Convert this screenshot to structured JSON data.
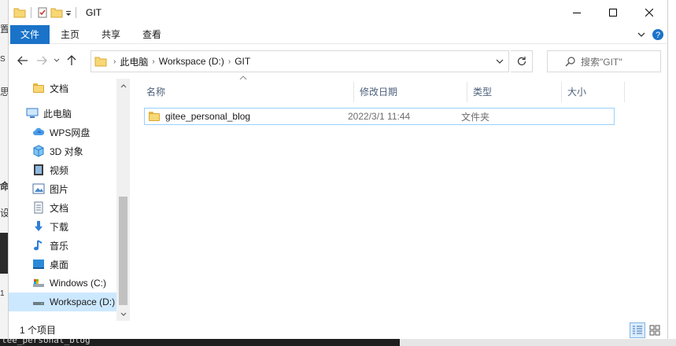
{
  "window": {
    "title": "GIT"
  },
  "ribbon": {
    "tabs": [
      "文件",
      "主页",
      "共享",
      "查看"
    ]
  },
  "address": {
    "crumbs": [
      "此电脑",
      "Workspace (D:)",
      "GIT"
    ]
  },
  "search": {
    "placeholder": "搜索\"GIT\""
  },
  "navpane": {
    "items": [
      {
        "label": "文档",
        "icon": "folder-icon"
      },
      {
        "label": "此电脑",
        "icon": "computer-icon"
      },
      {
        "label": "WPS网盘",
        "icon": "cloud-icon"
      },
      {
        "label": "3D 对象",
        "icon": "cube-icon"
      },
      {
        "label": "视频",
        "icon": "video-icon"
      },
      {
        "label": "图片",
        "icon": "picture-icon"
      },
      {
        "label": "文档",
        "icon": "document-icon"
      },
      {
        "label": "下载",
        "icon": "download-icon"
      },
      {
        "label": "音乐",
        "icon": "music-icon"
      },
      {
        "label": "桌面",
        "icon": "desktop-icon"
      },
      {
        "label": "Windows (C:)",
        "icon": "drive-c-icon"
      },
      {
        "label": "Workspace (D:)",
        "icon": "drive-d-icon"
      }
    ]
  },
  "columns": {
    "name": "名称",
    "date": "修改日期",
    "type": "类型",
    "size": "大小"
  },
  "files": [
    {
      "name": "gitee_personal_blog",
      "date": "2022/3/1 11:44",
      "type": "文件夹",
      "size": ""
    }
  ],
  "status": {
    "count": "1 个项目"
  },
  "background": {
    "terminal_text": "tee_personal_blog",
    "left_fragments": [
      "置",
      "S",
      "思",
      "命",
      "设",
      "1"
    ]
  },
  "colors": {
    "file_tab": "#1a73c8",
    "selection": "#cce8ff",
    "row_border": "#99d1ff",
    "header_text": "#4c607a",
    "folder": "#f8d775"
  }
}
